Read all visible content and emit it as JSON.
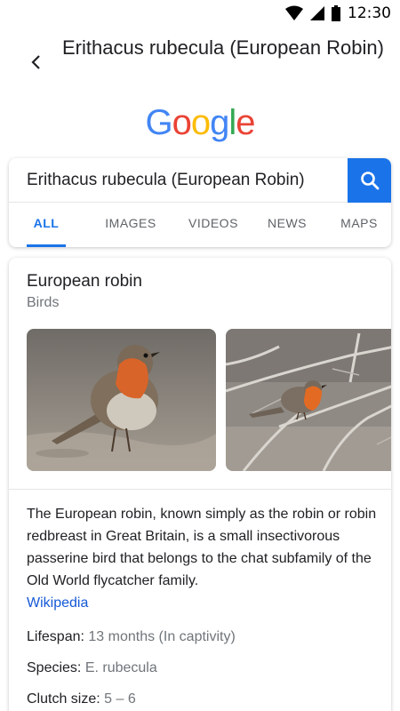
{
  "status_bar": {
    "time": "12:30",
    "icons": [
      "wifi-icon",
      "cell-signal-icon",
      "battery-icon"
    ]
  },
  "app_bar": {
    "back_icon": "chevron-left-icon",
    "title": "Erithacus rubecula (European Robin)"
  },
  "logo": {
    "letters": [
      "G",
      "o",
      "o",
      "g",
      "l",
      "e"
    ],
    "colors": [
      "#4285F4",
      "#EA4335",
      "#FBBC05",
      "#4285F4",
      "#34A853",
      "#EA4335"
    ]
  },
  "search": {
    "query": "Erithacus rubecula (European Robin)",
    "button_icon": "search-icon",
    "accent": "#1a73e8"
  },
  "tabs": [
    {
      "label": "ALL",
      "active": true
    },
    {
      "label": "IMAGES",
      "active": false
    },
    {
      "label": "VIDEOS",
      "active": false
    },
    {
      "label": "NEWS",
      "active": false
    },
    {
      "label": "MAPS",
      "active": false
    }
  ],
  "knowledge_panel": {
    "title": "European robin",
    "subtitle": "Birds",
    "images": [
      "robin-photo-ground",
      "robin-photo-branch"
    ],
    "description": "The European robin, known simply as the robin or robin redbreast in Great Britain, is a small insectivorous passerine bird that belongs to the chat subfamily of the Old World flycatcher family.",
    "source_link": "Wikipedia",
    "facts": [
      {
        "label": "Lifespan",
        "value": "13 months (In captivity)"
      },
      {
        "label": "Species",
        "value": "E. rubecula"
      },
      {
        "label": "Clutch size",
        "value": "5 – 6"
      }
    ]
  }
}
